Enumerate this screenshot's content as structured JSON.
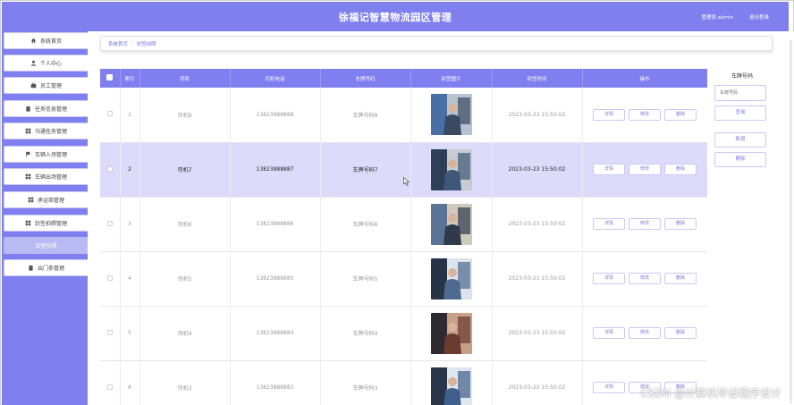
{
  "header": {
    "title": "徐福记智慧物流园区管理",
    "user": "管理员 admin",
    "logout": "退出登录"
  },
  "sidebar": {
    "items": [
      {
        "label": "系统首页",
        "icon": "home-icon"
      },
      {
        "label": "个人中心",
        "icon": "user-icon"
      },
      {
        "label": "员工管理",
        "icon": "briefcase-icon"
      },
      {
        "label": "任务信息管理",
        "icon": "clipboard-icon"
      },
      {
        "label": "沟通任务管理",
        "icon": "grid-icon"
      },
      {
        "label": "车辆入场管理",
        "icon": "flag-icon"
      },
      {
        "label": "车辆出场管理",
        "icon": "grid-icon"
      },
      {
        "label": "承运商管理",
        "icon": "grid-icon"
      },
      {
        "label": "封签拍照管理",
        "icon": "grid-icon"
      },
      {
        "label": "封签拍照",
        "icon": "",
        "active": true
      },
      {
        "label": "出门条管理",
        "icon": "clipboard-icon"
      }
    ]
  },
  "breadcrumb": {
    "home": "系统首页",
    "sep": "⁝",
    "current": "封签拍照"
  },
  "table": {
    "headers": [
      "",
      "索引",
      "司机",
      "司机电话",
      "车牌号码",
      "封签图片",
      "封签时间",
      "操作"
    ],
    "actions": {
      "detail": "详情",
      "edit": "修改",
      "delete": "删除"
    },
    "rows": [
      {
        "index": "1",
        "driver": "司机8",
        "phone": "13823888888",
        "plate": "车牌号码8",
        "time": "2023-03-23 15:50:02",
        "highlight": false
      },
      {
        "index": "2",
        "driver": "司机7",
        "phone": "13823888887",
        "plate": "车牌号码7",
        "time": "2023-03-23 15:50:02",
        "highlight": true
      },
      {
        "index": "3",
        "driver": "司机6",
        "phone": "13823888886",
        "plate": "车牌号码6",
        "time": "2023-03-23 15:50:02",
        "highlight": false
      },
      {
        "index": "4",
        "driver": "司机5",
        "phone": "13823888885",
        "plate": "车牌号码5",
        "time": "2023-03-23 15:50:02",
        "highlight": false
      },
      {
        "index": "5",
        "driver": "司机4",
        "phone": "13823888884",
        "plate": "车牌号码4",
        "time": "2023-03-23 15:50:02",
        "highlight": false
      },
      {
        "index": "6",
        "driver": "司机3",
        "phone": "13823888883",
        "plate": "车牌号码3",
        "time": "2023-03-23 15:50:02",
        "highlight": false
      }
    ]
  },
  "search": {
    "label": "车牌号码",
    "placeholder": "车牌号码",
    "query": "查询",
    "add": "新增",
    "delete": "删除"
  },
  "watermark": "CSDN @计算机毕设程序设计",
  "colors": {
    "accent": "#7f7ff0",
    "highlight_row": "#dcdcfa",
    "active_menu": "#b9b9f3"
  }
}
